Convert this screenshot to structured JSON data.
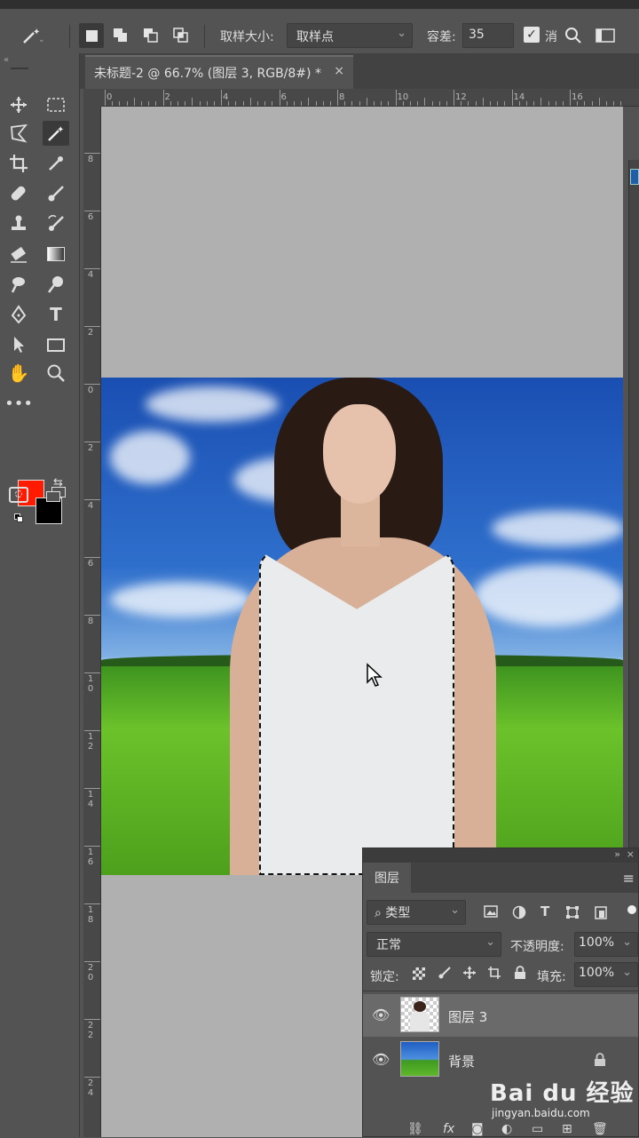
{
  "options": {
    "sample_size_label": "取样大小:",
    "sample_size_value": "取样点",
    "tolerance_label": "容差:",
    "tolerance_value": "35",
    "antialias_label": "消"
  },
  "document": {
    "tab_title": "未标题-2 @ 66.7% (图层 3, RGB/8#) *",
    "close": "×"
  },
  "ruler": {
    "h": [
      "0",
      "2",
      "4",
      "6",
      "8",
      "10",
      "12",
      "14",
      "16"
    ],
    "v": [
      "8",
      "6",
      "4",
      "2",
      "0",
      "2",
      "4",
      "6",
      "8",
      "1\n0",
      "1\n2",
      "1\n4",
      "1\n6",
      "1\n8",
      "2\n0",
      "2\n2",
      "2\n4"
    ]
  },
  "colors": {
    "foreground": "#ff1a00",
    "background": "#000000"
  },
  "layers_panel": {
    "tab": "图层",
    "filter_label": "类型",
    "blend_mode": "正常",
    "opacity_label": "不透明度:",
    "opacity_value": "100%",
    "lock_label": "锁定:",
    "fill_label": "填充:",
    "fill_value": "100%",
    "layers": [
      {
        "name": "图层 3",
        "selected": true
      },
      {
        "name": "背景",
        "locked": true
      }
    ]
  },
  "watermark": {
    "logo": "Bai du 经验",
    "url": "jingyan.baidu.com"
  }
}
